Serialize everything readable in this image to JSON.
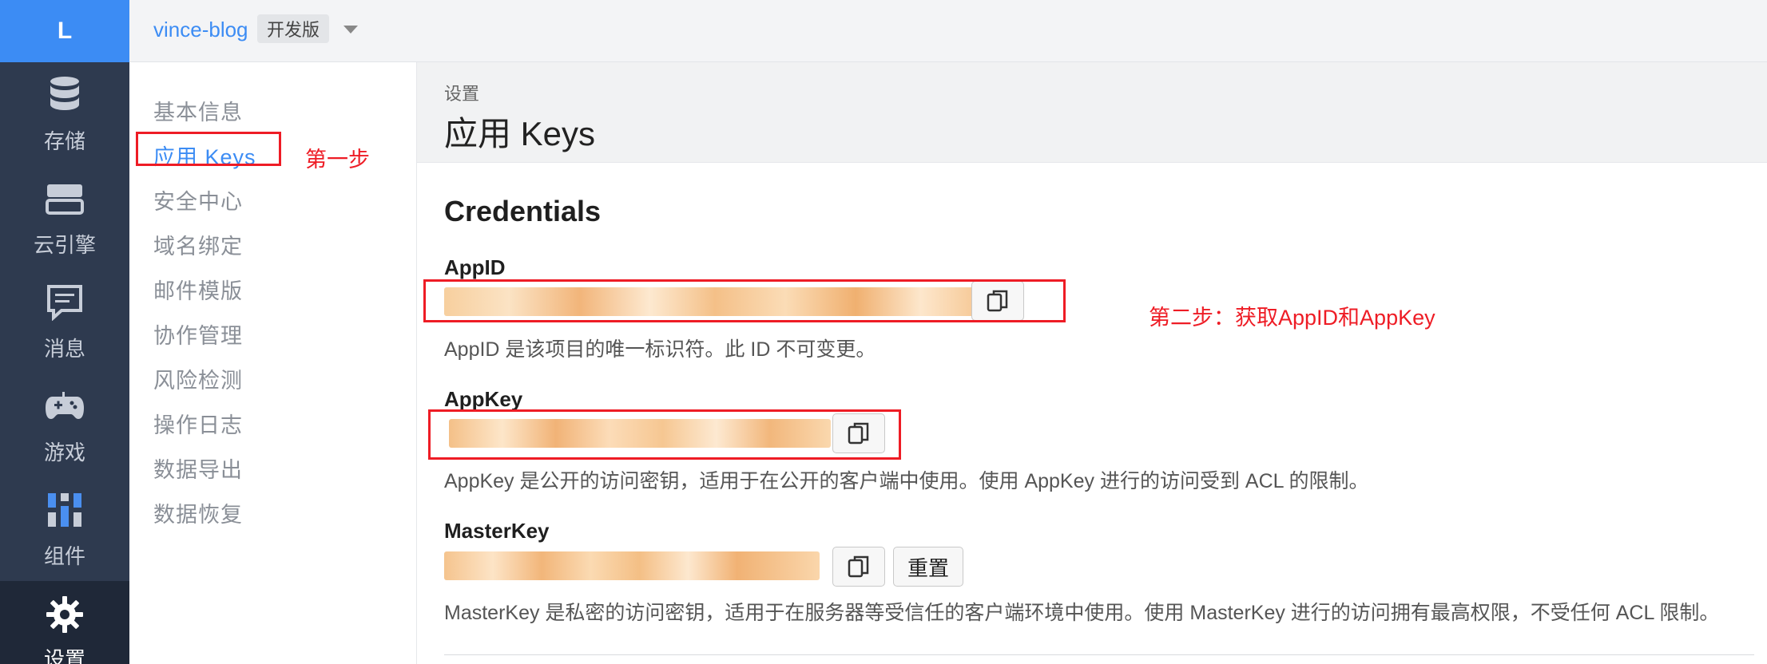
{
  "rail": {
    "logo": "L",
    "items": [
      {
        "label": "存储",
        "icon": "database-icon"
      },
      {
        "label": "云引擎",
        "icon": "server-icon"
      },
      {
        "label": "消息",
        "icon": "message-icon"
      },
      {
        "label": "游戏",
        "icon": "gamepad-icon"
      },
      {
        "label": "组件",
        "icon": "components-icon"
      },
      {
        "label": "设置",
        "icon": "gear-icon",
        "active": true
      }
    ]
  },
  "topbar": {
    "app_name": "vince-blog",
    "env_badge": "开发版"
  },
  "submenu": {
    "items": [
      {
        "label": "基本信息"
      },
      {
        "label": "应用 Keys",
        "active": true
      },
      {
        "label": "安全中心"
      },
      {
        "label": "域名绑定"
      },
      {
        "label": "邮件模版"
      },
      {
        "label": "协作管理"
      },
      {
        "label": "风险检测"
      },
      {
        "label": "操作日志"
      },
      {
        "label": "数据导出"
      },
      {
        "label": "数据恢复"
      }
    ]
  },
  "page": {
    "breadcrumb": "设置",
    "title": "应用 Keys",
    "section_title": "Credentials"
  },
  "credentials": {
    "appid": {
      "label": "AppID",
      "desc": "AppID 是该项目的唯一标识符。此 ID 不可变更。"
    },
    "appkey": {
      "label": "AppKey",
      "desc": "AppKey 是公开的访问密钥，适用于在公开的客户端中使用。使用 AppKey 进行的访问受到 ACL 的限制。"
    },
    "masterkey": {
      "label": "MasterKey",
      "reset_label": "重置",
      "desc": "MasterKey 是私密的访问密钥，适用于在服务器等受信任的客户端环境中使用。使用 MasterKey 进行的访问拥有最高权限，不受任何 ACL 限制。"
    }
  },
  "annotations": {
    "step1": "第一步",
    "step2": "第二步：获取AppID和AppKey"
  },
  "colors": {
    "accent": "#3c8cf4",
    "rail_bg": "#2e3a4f",
    "annotation_red": "#ee1c25",
    "mask_orange": "#f5c28a"
  }
}
